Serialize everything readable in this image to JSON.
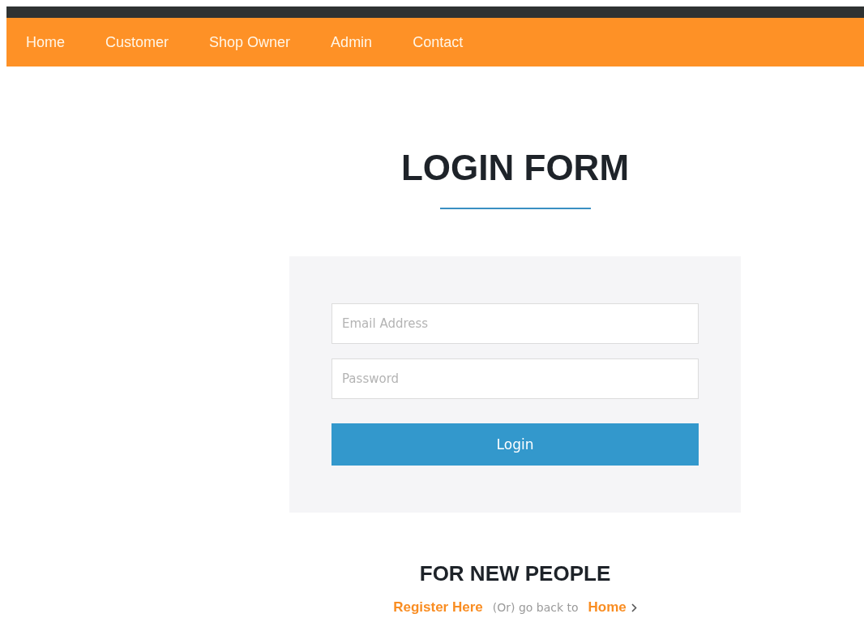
{
  "nav": [
    {
      "label": "Home"
    },
    {
      "label": "Customer"
    },
    {
      "label": "Shop Owner"
    },
    {
      "label": "Admin"
    },
    {
      "label": "Contact"
    }
  ],
  "title": "LOGIN FORM",
  "form": {
    "fields": [
      {
        "placeholder": "Email Address"
      },
      {
        "placeholder": "Password"
      }
    ],
    "button": "Login"
  },
  "new_people": {
    "heading": "FOR NEW PEOPLE",
    "register_link": "Register Here",
    "middle_text": "(Or) go back to",
    "home_link": "Home"
  }
}
